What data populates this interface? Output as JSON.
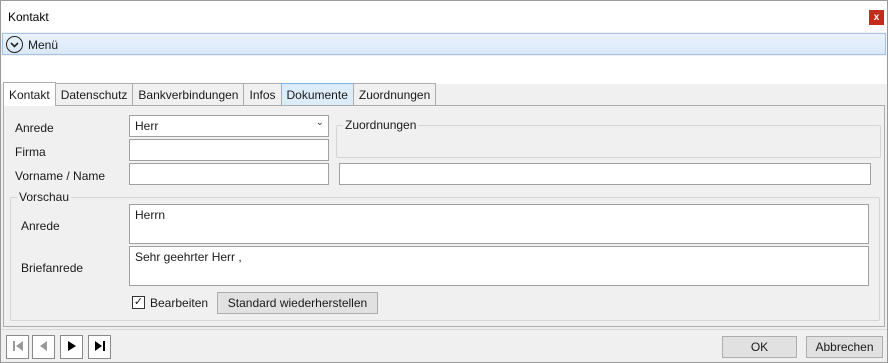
{
  "window": {
    "title": "Kontakt",
    "close_label": "x"
  },
  "menu": {
    "label": "Menü",
    "icon": "chevron-down-icon"
  },
  "tabs": [
    {
      "label": "Kontakt"
    },
    {
      "label": "Datenschutz"
    },
    {
      "label": "Bankverbindungen"
    },
    {
      "label": "Infos"
    },
    {
      "label": "Dokumente"
    },
    {
      "label": "Zuordnungen"
    }
  ],
  "form": {
    "anrede_label": "Anrede",
    "anrede_value": "Herr",
    "firma_label": "Firma",
    "firma_value": "",
    "name_label": "Vorname / Name",
    "vorname_value": "",
    "name_value": "",
    "zuordnungen_title": "Zuordnungen"
  },
  "preview": {
    "title": "Vorschau",
    "anrede_label": "Anrede",
    "anrede_value": "Herrn",
    "briefanrede_label": "Briefanrede",
    "briefanrede_value": "Sehr geehrter Herr ,",
    "bearbeiten_label": "Bearbeiten",
    "bearbeiten_checked": true,
    "reset_label": "Standard wiederherstellen"
  },
  "footer": {
    "ok_label": "OK",
    "cancel_label": "Abbrechen"
  },
  "colors": {
    "close_bg": "#c42b1c",
    "menu_bg": "#d9e8f8",
    "active_tab_blue": "#ddecf9"
  }
}
